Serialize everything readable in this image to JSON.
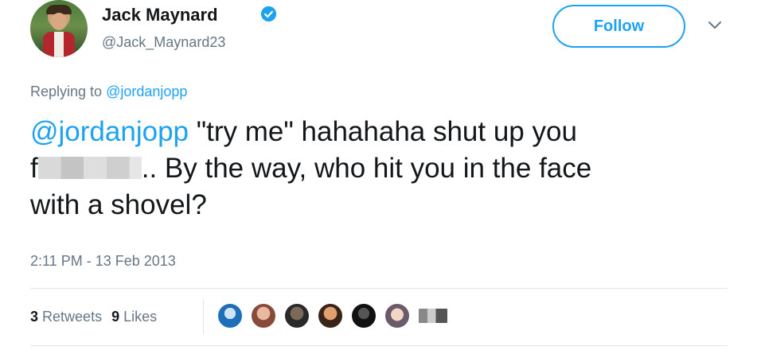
{
  "user": {
    "name": "Jack Maynard",
    "handle": "@Jack_Maynard23",
    "verified": true,
    "avatar_icon": "user-avatar"
  },
  "actions": {
    "follow_label": "Follow",
    "menu_icon": "chevron-down-icon"
  },
  "reply": {
    "prefix": "Replying to",
    "mention": "@jordanjopp"
  },
  "tweet": {
    "mention": "@jordanjopp",
    "text_part1": " \"try me\" hahahaha shut up you",
    "censored_lead": "f",
    "text_part2": ".. By the way, who hit you in the face",
    "text_part3": "with a shovel?"
  },
  "timestamp": "2:11 PM - 13 Feb 2013",
  "stats": {
    "retweets_count": "3",
    "retweets_label": "Retweets",
    "likes_count": "9",
    "likes_label": "Likes"
  },
  "colors": {
    "accent": "#1da1f2",
    "muted": "#657786",
    "text": "#14171a"
  }
}
